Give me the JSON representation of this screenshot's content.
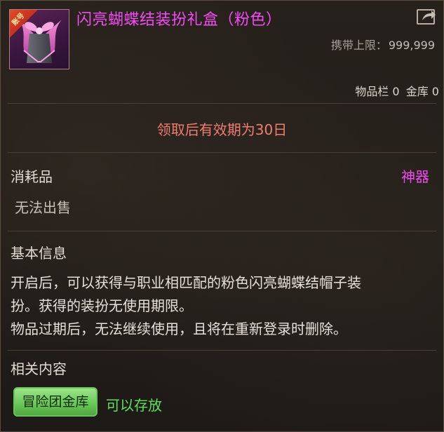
{
  "item": {
    "badge": "账号",
    "title": "闪亮蝴蝶结装扮礼盒（粉色）"
  },
  "carry": {
    "label": "携带上限：",
    "value": "999,999"
  },
  "storage": {
    "inventory": "物品栏 0",
    "vault": "金库 0"
  },
  "expire_text": "领取后有效期为30日",
  "category": {
    "type": "消耗品",
    "grade": "神器"
  },
  "sell_text": "无法出售",
  "basic_info": {
    "title": "基本信息",
    "lines": [
      "开启后，可以获得与职业相匹配的粉色闪亮蝴蝶结帽子装",
      "扮。获得的装扮无使用期限。",
      "物品过期后，无法继续使用，且将在重新登录时删除。"
    ]
  },
  "related": {
    "title": "相关内容",
    "tag": "冒险团金库",
    "status": "可以存放"
  },
  "colors": {
    "title": "#f24bf2",
    "grade": "#f24bf2",
    "expire": "#f07d70",
    "status_green": "#5fe05a",
    "tag_green": "#7ed46b"
  },
  "icons": {
    "item": "pink-gift-box-icon",
    "share": "share-arrow-icon"
  }
}
